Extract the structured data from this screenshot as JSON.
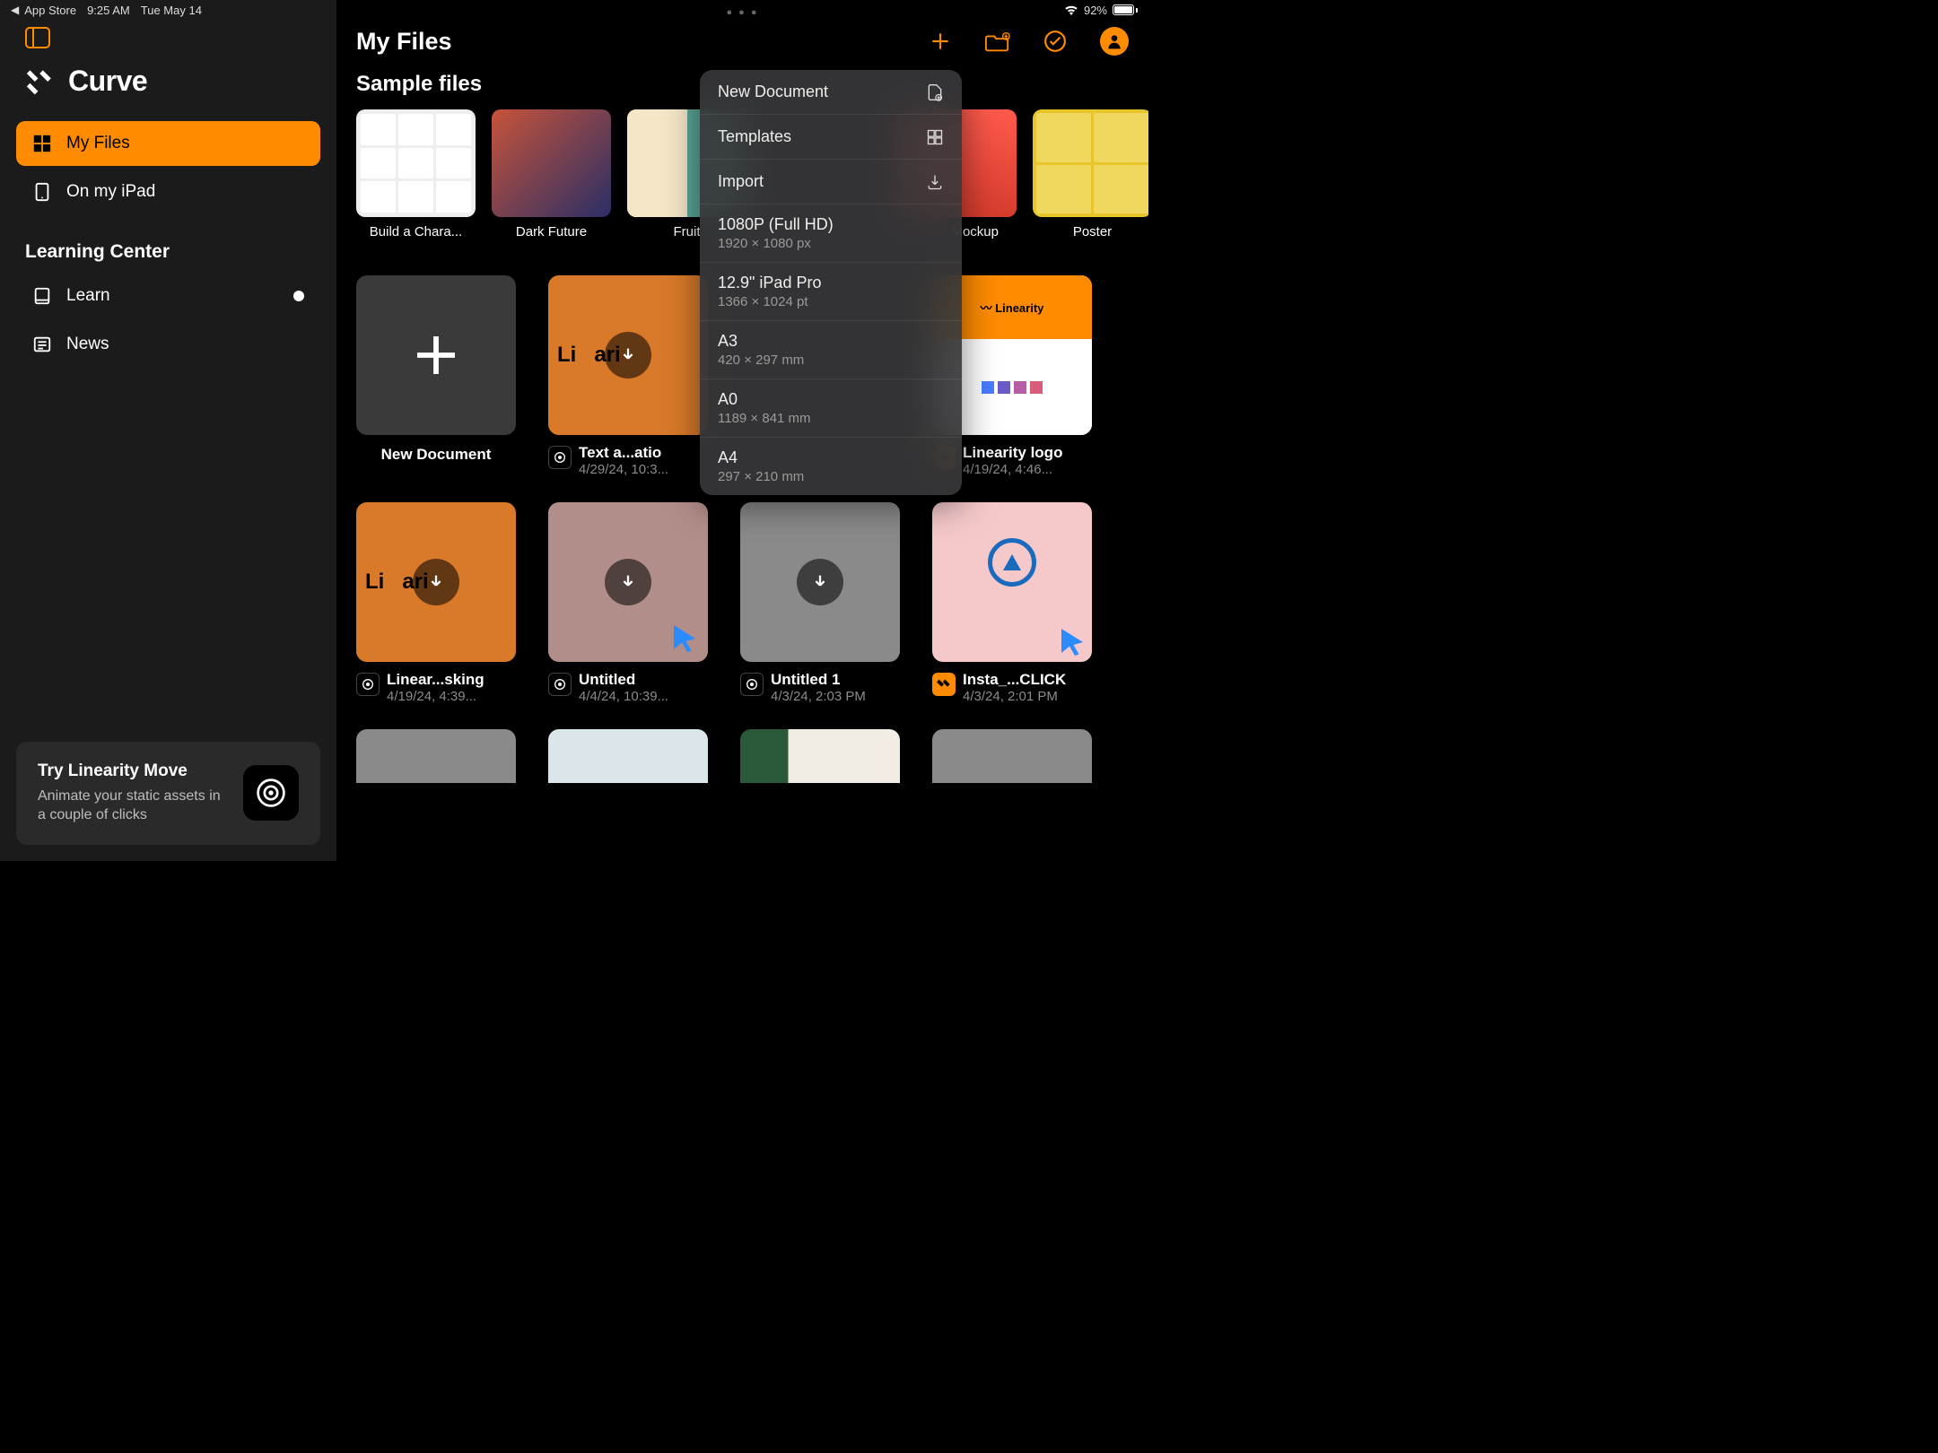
{
  "status": {
    "back_app": "App Store",
    "time": "9:25 AM",
    "date": "Tue May 14",
    "battery_pct": "92%"
  },
  "app": {
    "name": "Curve"
  },
  "sidebar": {
    "items": [
      {
        "label": "My Files"
      },
      {
        "label": "On my iPad"
      }
    ],
    "learning_label": "Learning Center",
    "learning": [
      {
        "label": "Learn",
        "dot": true
      },
      {
        "label": "News"
      }
    ],
    "promo": {
      "title": "Try Linearity Move",
      "body": "Animate your static assets in a couple of clicks"
    }
  },
  "header": {
    "title": "My Files"
  },
  "samples": {
    "title": "Sample files",
    "items": [
      {
        "label": "Build a Chara..."
      },
      {
        "label": "Dark Future"
      },
      {
        "label": "Fruit"
      },
      {
        "label": "Mockup"
      },
      {
        "label": "Poster"
      }
    ]
  },
  "files": {
    "new_doc_label": "New Document",
    "items": [
      {
        "name": "Text a...atio",
        "date": "4/29/24, 10:3...",
        "thumb": "orange"
      },
      {
        "name": "Linearity logo",
        "date": "4/19/24, 4:46...",
        "thumb": "logo",
        "type_orange": true
      },
      {
        "name": "Linear...sking",
        "date": "4/19/24, 4:39...",
        "thumb": "orange"
      },
      {
        "name": "Untitled",
        "date": "4/4/24, 10:39...",
        "thumb": "rose",
        "cursor": true
      },
      {
        "name": "Untitled 1",
        "date": "4/3/24, 2:03 PM",
        "thumb": "grey"
      },
      {
        "name": "Insta_...CLICK",
        "date": "4/3/24, 2:01 PM",
        "thumb": "pink",
        "cursor": true,
        "type_orange": true
      }
    ]
  },
  "dropdown": {
    "actions": [
      {
        "label": "New Document",
        "icon": "new-doc"
      },
      {
        "label": "Templates",
        "icon": "grid"
      },
      {
        "label": "Import",
        "icon": "import"
      }
    ],
    "presets": [
      {
        "title": "1080P (Full HD)",
        "sub": "1920 × 1080 px"
      },
      {
        "title": "12.9\" iPad Pro",
        "sub": "1366 × 1024 pt"
      },
      {
        "title": "A3",
        "sub": "420 × 297 mm"
      },
      {
        "title": "A0",
        "sub": "1189 × 841 mm"
      },
      {
        "title": "A4",
        "sub": "297 × 210 mm"
      }
    ]
  }
}
